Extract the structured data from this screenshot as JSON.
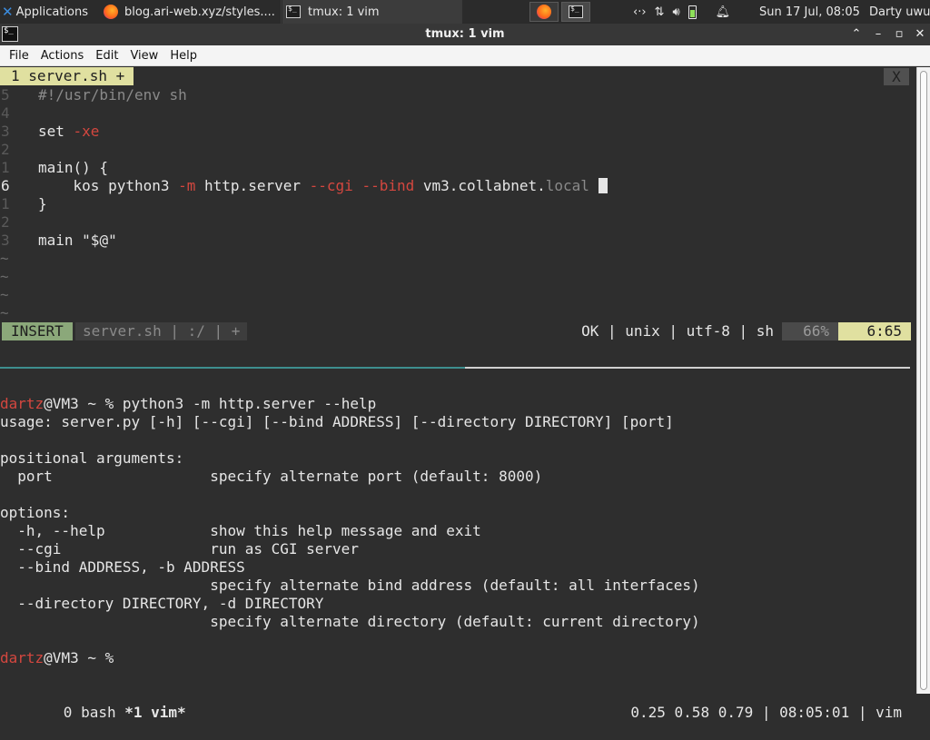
{
  "panel": {
    "applications_label": "Applications",
    "tasks": [
      {
        "label": "blog.ari-web.xyz/styles...."
      },
      {
        "label": "tmux: 1 vim"
      }
    ],
    "clock": "Sun 17 Jul, 08:05",
    "user": "Darty uwu",
    "colors": {
      "battery": "#8ee05a",
      "xfce_blue": "#3b8de0"
    }
  },
  "window": {
    "title": "tmux: 1 vim",
    "menu": [
      "File",
      "Actions",
      "Edit",
      "View",
      "Help"
    ]
  },
  "vim": {
    "tab_label": "1 server.sh +",
    "close_label": "X",
    "lines": [
      {
        "num": "5",
        "parts": [
          {
            "t": "#!/usr/bin/env sh",
            "c": "gray"
          }
        ]
      },
      {
        "num": "4",
        "parts": []
      },
      {
        "num": "3",
        "parts": [
          {
            "t": "set ",
            "c": "code"
          },
          {
            "t": "-xe",
            "c": "red"
          }
        ]
      },
      {
        "num": "2",
        "parts": []
      },
      {
        "num": "1",
        "parts": [
          {
            "t": "main() {",
            "c": "code"
          }
        ]
      },
      {
        "num": "6",
        "current": true,
        "parts": [
          {
            "t": "    kos python3 ",
            "c": "code"
          },
          {
            "t": "-m",
            "c": "red"
          },
          {
            "t": " http.server ",
            "c": "code"
          },
          {
            "t": "--cgi",
            "c": "red"
          },
          {
            "t": " ",
            "c": "code"
          },
          {
            "t": "--bind",
            "c": "red"
          },
          {
            "t": " vm3.collabnet.",
            "c": "code"
          },
          {
            "t": "local",
            "c": "gray"
          },
          {
            "t": " ",
            "c": "code"
          }
        ]
      },
      {
        "num": "1",
        "parts": [
          {
            "t": "}",
            "c": "code"
          }
        ]
      },
      {
        "num": "2",
        "parts": []
      },
      {
        "num": "3",
        "parts": [
          {
            "t": "main ",
            "c": "code"
          },
          {
            "t": "\"$@\"",
            "c": "code"
          }
        ]
      }
    ],
    "tildes": [
      "~",
      "~",
      "~",
      "~"
    ],
    "status": {
      "mode": "INSERT",
      "file": "server.sh | :/ | +",
      "info": "OK | unix | utf-8 | sh",
      "percent": "66%",
      "position": "6:65"
    }
  },
  "shell": {
    "prompt_user": "dartz",
    "prompt_rest": "@VM3 ~ % ",
    "command": "python3 -m http.server --help",
    "output": [
      "usage: server.py [-h] [--cgi] [--bind ADDRESS] [--directory DIRECTORY] [port]",
      "",
      "positional arguments:",
      "  port                  specify alternate port (default: 8000)",
      "",
      "options:",
      "  -h, --help            show this help message and exit",
      "  --cgi                 run as CGI server",
      "  --bind ADDRESS, -b ADDRESS",
      "                        specify alternate bind address (default: all interfaces)",
      "  --directory DIRECTORY, -d DIRECTORY",
      "                        specify alternate directory (default: current directory)",
      ""
    ],
    "final_prompt_rest": "@VM3 ~ % "
  },
  "tmux": {
    "win0": "0 bash ",
    "win1": "*1 vim*",
    "right": "0.25 0.58 0.79 | 08:05:01 | vim"
  }
}
